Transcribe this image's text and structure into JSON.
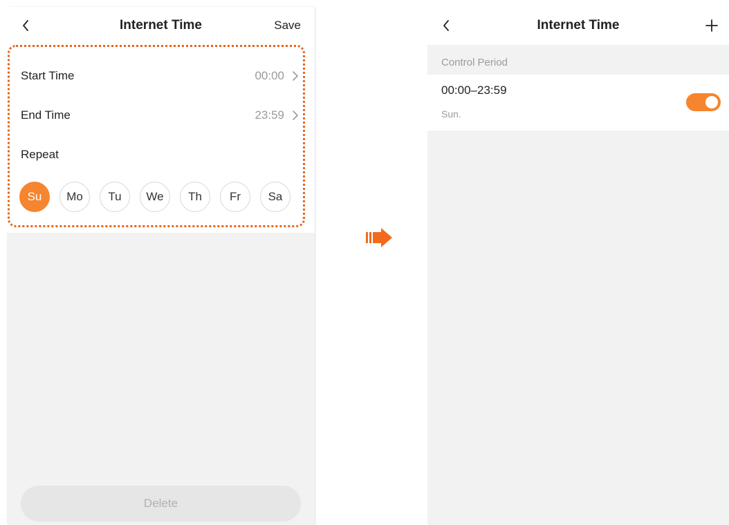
{
  "colors": {
    "accent": "#f5852e",
    "highlight": "#e8631c",
    "background": "#f2f2f2",
    "surface": "#ffffff",
    "muted_text": "#9b9b9b"
  },
  "left_screen": {
    "header": {
      "back_icon": "chevron-left-icon",
      "title": "Internet Time",
      "save_label": "Save"
    },
    "form": {
      "start_time": {
        "label": "Start Time",
        "value": "00:00"
      },
      "end_time": {
        "label": "End Time",
        "value": "23:59"
      },
      "repeat": {
        "label": "Repeat"
      },
      "days": [
        {
          "label": "Su",
          "selected": true
        },
        {
          "label": "Mo",
          "selected": false
        },
        {
          "label": "Tu",
          "selected": false
        },
        {
          "label": "We",
          "selected": false
        },
        {
          "label": "Th",
          "selected": false
        },
        {
          "label": "Fr",
          "selected": false
        },
        {
          "label": "Sa",
          "selected": false
        }
      ]
    },
    "delete_label": "Delete"
  },
  "transition_icon": "arrow-right-icon",
  "right_screen": {
    "header": {
      "back_icon": "chevron-left-icon",
      "title": "Internet Time",
      "add_icon": "plus-icon"
    },
    "section_label": "Control Period",
    "periods": [
      {
        "time": "00:00–23:59",
        "days": "Sun.",
        "enabled": true
      }
    ]
  }
}
